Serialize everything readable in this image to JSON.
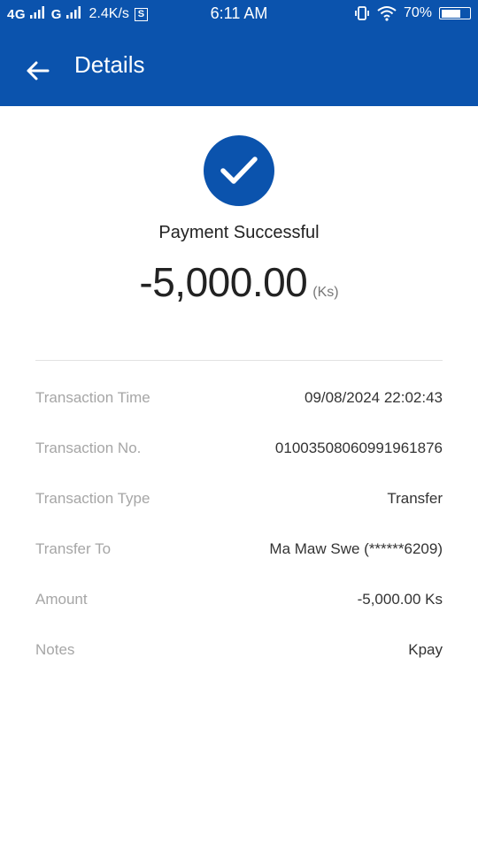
{
  "status_bar": {
    "network": "4G",
    "network2": "G",
    "speed": "2.4K/s",
    "s_icon": "S",
    "time": "6:11 AM",
    "battery": "70%",
    "battery_level": 0.7
  },
  "appbar": {
    "title": "Details"
  },
  "result": {
    "status": "Payment Successful",
    "amount": "-5,000.00",
    "unit": "(Ks)"
  },
  "details": [
    {
      "label": "Transaction Time",
      "value": "09/08/2024 22:02:43"
    },
    {
      "label": "Transaction No.",
      "value": "01003508060991961876"
    },
    {
      "label": "Transaction Type",
      "value": "Transfer"
    },
    {
      "label": "Transfer To",
      "value": "Ma Maw Swe (******6209)"
    },
    {
      "label": "Amount",
      "value": "-5,000.00 Ks"
    },
    {
      "label": "Notes",
      "value": "Kpay"
    }
  ],
  "colors": {
    "brand": "#0b53ad",
    "label": "#a6a6a6",
    "divider": "#e2e2e2"
  }
}
